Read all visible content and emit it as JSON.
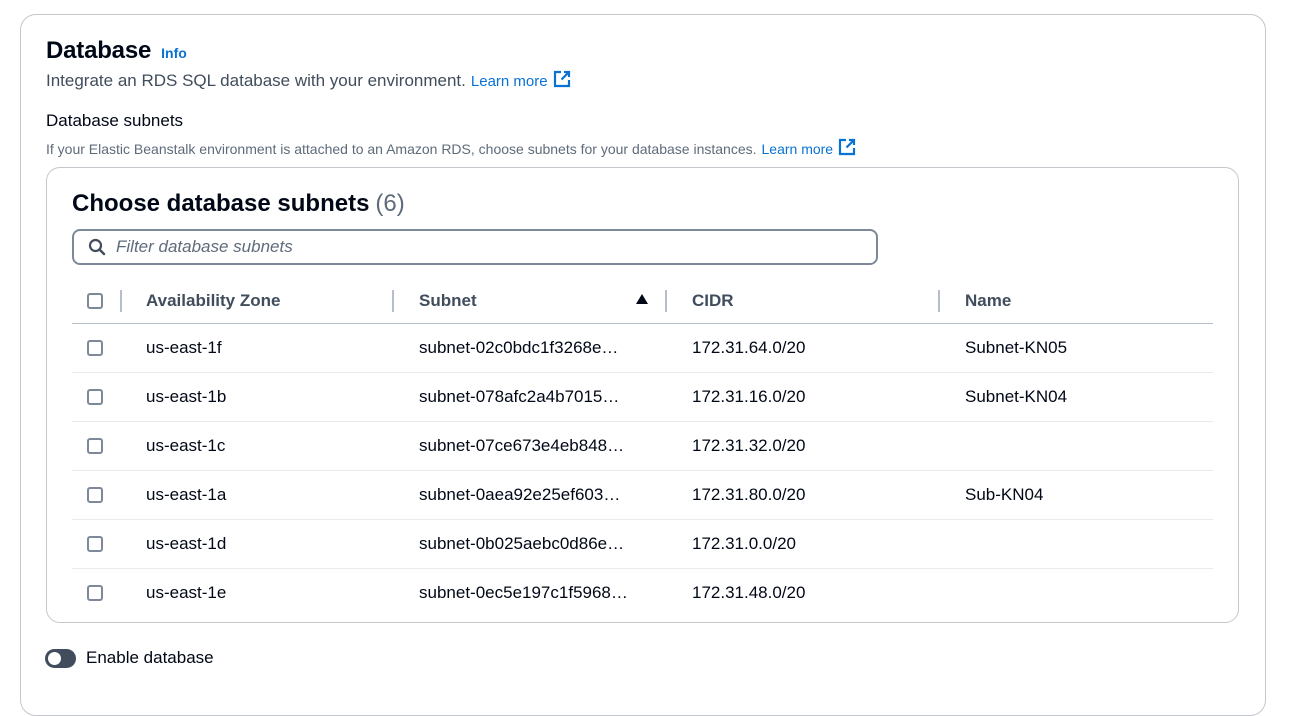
{
  "section": {
    "title": "Database",
    "info_label": "Info",
    "description": "Integrate an RDS SQL database with your environment.",
    "learn_more": "Learn more"
  },
  "subnets_field": {
    "label": "Database subnets",
    "description": "If your Elastic Beanstalk environment is attached to an Amazon RDS, choose subnets for your database instances.",
    "learn_more": "Learn more"
  },
  "table": {
    "title": "Choose database subnets",
    "count": "(6)",
    "filter_placeholder": "Filter database subnets",
    "columns": {
      "az": "Availability Zone",
      "subnet": "Subnet",
      "cidr": "CIDR",
      "name": "Name"
    },
    "rows": [
      {
        "az": "us-east-1f",
        "subnet": "subnet-02c0bdc1f3268e…",
        "cidr": "172.31.64.0/20",
        "name": "Subnet-KN05"
      },
      {
        "az": "us-east-1b",
        "subnet": "subnet-078afc2a4b7015…",
        "cidr": "172.31.16.0/20",
        "name": "Subnet-KN04"
      },
      {
        "az": "us-east-1c",
        "subnet": "subnet-07ce673e4eb848…",
        "cidr": "172.31.32.0/20",
        "name": ""
      },
      {
        "az": "us-east-1a",
        "subnet": "subnet-0aea92e25ef603…",
        "cidr": "172.31.80.0/20",
        "name": "Sub-KN04"
      },
      {
        "az": "us-east-1d",
        "subnet": "subnet-0b025aebc0d86e…",
        "cidr": "172.31.0.0/20",
        "name": ""
      },
      {
        "az": "us-east-1e",
        "subnet": "subnet-0ec5e197c1f5968…",
        "cidr": "172.31.48.0/20",
        "name": ""
      }
    ]
  },
  "enable_database": {
    "label": "Enable database",
    "enabled": false
  },
  "colors": {
    "link": "#0972d3",
    "text": "#000716",
    "muted": "#5f6b7a",
    "toggle_off": "#414d5c"
  },
  "icons": {
    "info": "info-link",
    "external": "external-link-icon",
    "search": "search-icon",
    "sort": "sort-ascending-icon"
  }
}
